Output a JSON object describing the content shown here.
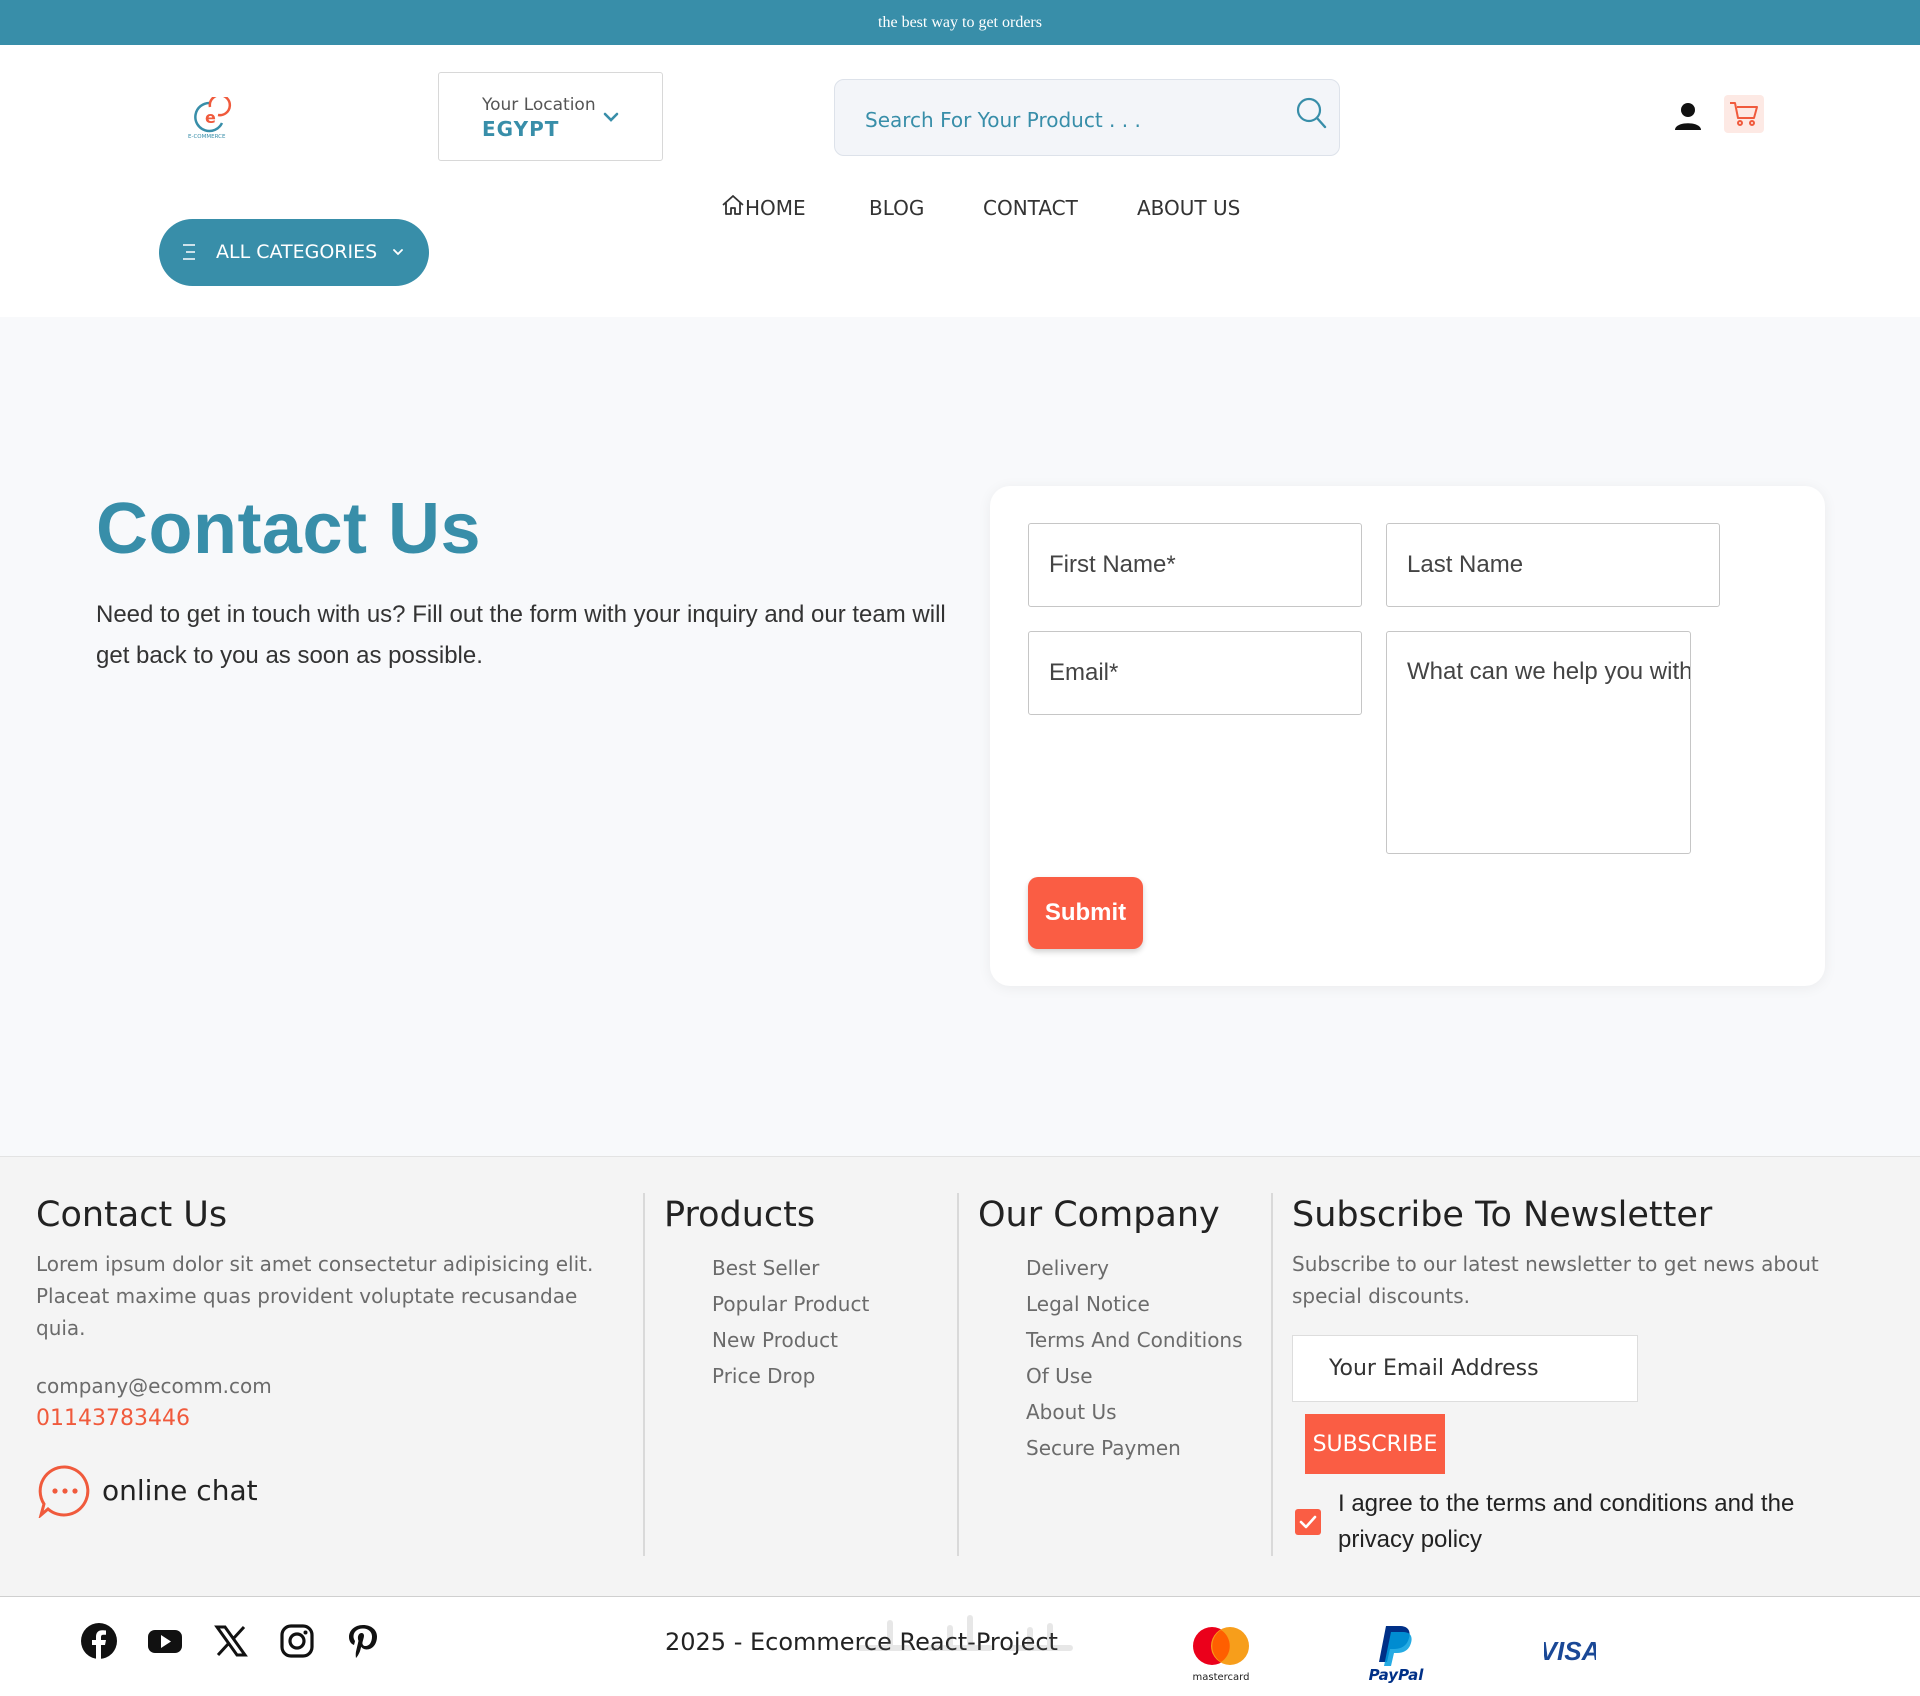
{
  "topbar": {
    "text": "the best way to get orders"
  },
  "header": {
    "logo_text": "E-COMMERCE",
    "location_label": "Your Location",
    "location_value": "EGYPT",
    "search_placeholder": "Search For Your Product . . ."
  },
  "nav": {
    "categories_label": "ALL CATEGORIES",
    "items": [
      "HOME",
      "BLOG",
      "CONTACT",
      "ABOUT US"
    ]
  },
  "hero": {
    "title": "Contact Us",
    "description": "Need to get in touch with us? Fill out the form with your inquiry and our team will get back to you as soon as possible."
  },
  "form": {
    "first_name_placeholder": "First Name*",
    "last_name_placeholder": "Last Name",
    "email_placeholder": "Email*",
    "message_placeholder": "What can we help you with?",
    "submit_label": "Submit"
  },
  "footer": {
    "contact": {
      "title": "Contact Us",
      "description": "Lorem ipsum dolor sit amet consectetur adipisicing elit. Placeat maxime quas provident voluptate recusandae quia.",
      "email": "company@ecomm.com",
      "phone": "01143783446",
      "chat_label": "online chat"
    },
    "products": {
      "title": "Products",
      "links": [
        "Best Seller",
        "Popular Product",
        "New Product",
        "Price Drop"
      ]
    },
    "company": {
      "title": "Our Company",
      "links": [
        "Delivery",
        "Legal Notice",
        "Terms And Conditions",
        "Of Use",
        "About Us",
        "Secure Paymen"
      ]
    },
    "newsletter": {
      "title": "Subscribe To Newsletter",
      "description": "Subscribe to our latest newsletter to get news about special discounts.",
      "email_placeholder": "Your Email Address",
      "button_label": "SUBSCRIBE",
      "terms_label": "I agree to the terms and conditions and the privacy policy"
    }
  },
  "bottom": {
    "copyright": "2025 - Ecommerce React-Project",
    "social_icons": [
      "facebook-icon",
      "youtube-icon",
      "x-icon",
      "instagram-icon",
      "pinterest-icon"
    ],
    "payments": {
      "mastercard": "mastercard",
      "paypal": "PayPal",
      "visa": "VISA"
    }
  },
  "colors": {
    "primary": "#388ea9",
    "accent": "#fa5d44",
    "background": "#f8f9fb"
  }
}
